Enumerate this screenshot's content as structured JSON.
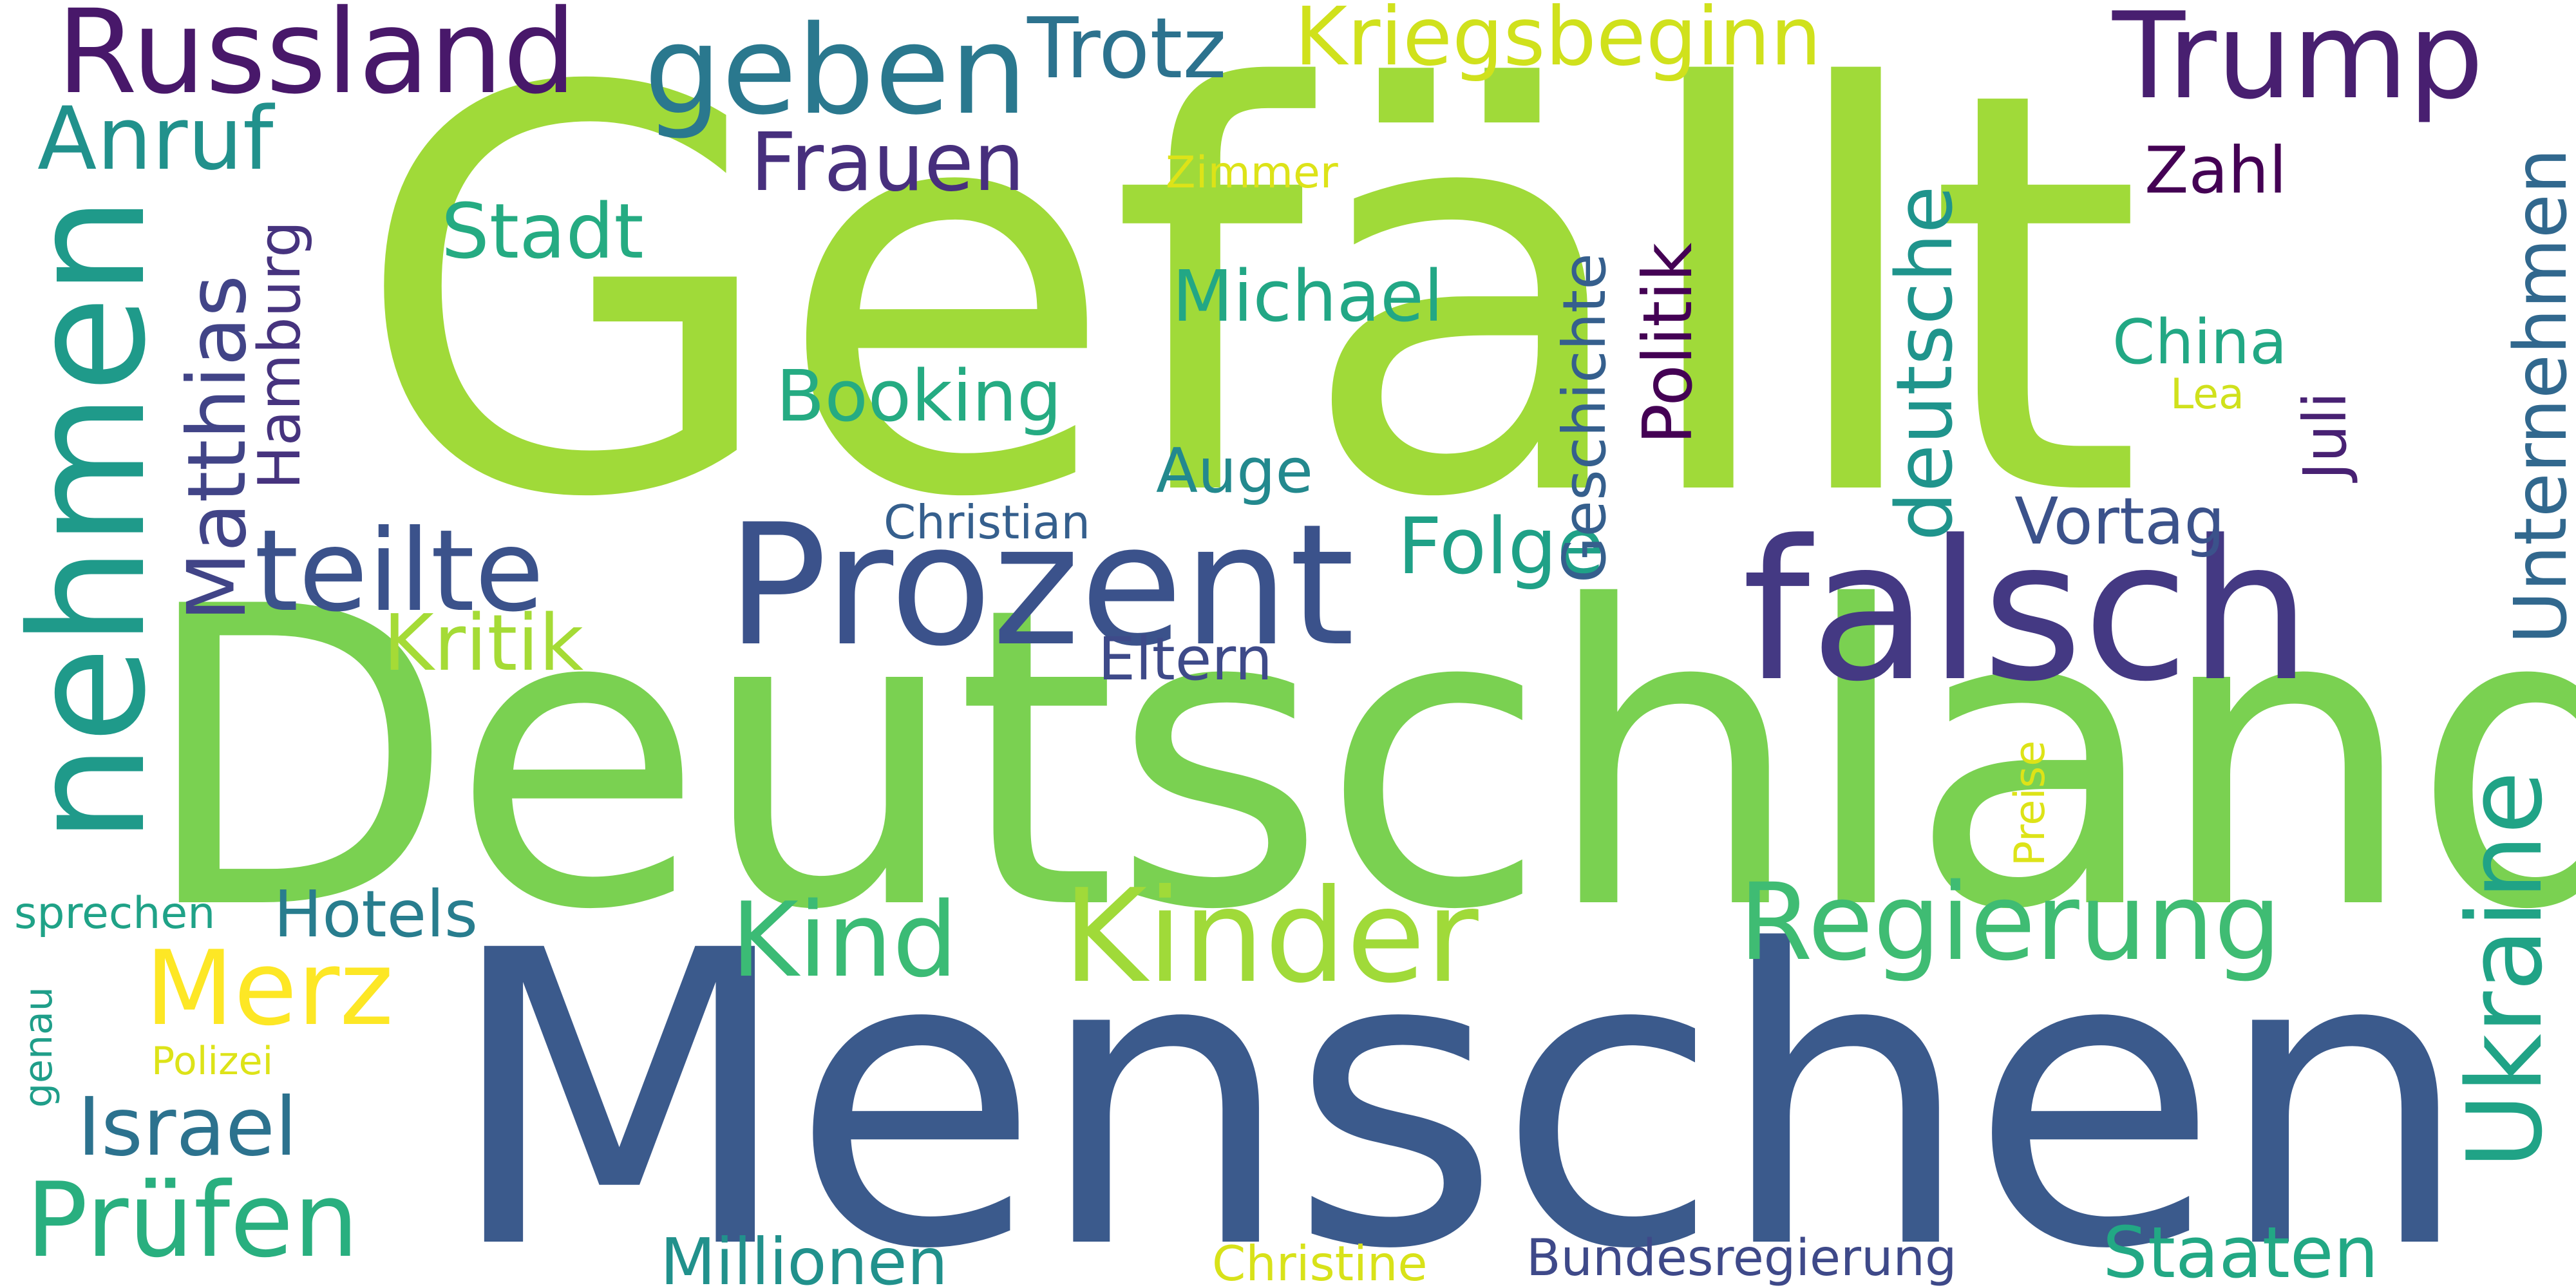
{
  "words": {
    "gefaellt": {
      "text": "Gefällt",
      "color": "#a0da39"
    },
    "deutschland": {
      "text": "Deutschland",
      "color": "#7ad151"
    },
    "menschen": {
      "text": "Menschen",
      "color": "#3b5a8c"
    },
    "prozent": {
      "text": "Prozent",
      "color": "#3b528b"
    },
    "falsch": {
      "text": "falsch",
      "color": "#443983"
    },
    "nehmen": {
      "text": "nehmen",
      "color": "#1f9a8a"
    },
    "kinder": {
      "text": "Kinder",
      "color": "#a0da39"
    },
    "russland": {
      "text": "Russland",
      "color": "#48186a"
    },
    "trump": {
      "text": "Trump",
      "color": "#481f70"
    },
    "geben": {
      "text": "geben",
      "color": "#2a788e"
    },
    "kriegsbeginn": {
      "text": "Kriegsbeginn",
      "color": "#d0e11c"
    },
    "trotz": {
      "text": "Trotz",
      "color": "#2c728e"
    },
    "anruf": {
      "text": "Anruf",
      "color": "#21918c"
    },
    "frauen": {
      "text": "Frauen",
      "color": "#472f7d"
    },
    "zimmer": {
      "text": "Zimmer",
      "color": "#dde318"
    },
    "zahl": {
      "text": "Zahl",
      "color": "#440154"
    },
    "stadt": {
      "text": "Stadt",
      "color": "#25ab82"
    },
    "michael": {
      "text": "Michael",
      "color": "#22a785"
    },
    "china": {
      "text": "China",
      "color": "#22a884"
    },
    "lea": {
      "text": "Lea",
      "color": "#d0e11c"
    },
    "booking": {
      "text": "Booking",
      "color": "#25ab82"
    },
    "auge": {
      "text": "Auge",
      "color": "#23898e"
    },
    "christian": {
      "text": "Christian",
      "color": "#355f8d"
    },
    "vortag": {
      "text": "Vortag",
      "color": "#3b528b"
    },
    "teilte": {
      "text": "teilte",
      "color": "#3b528b"
    },
    "folge": {
      "text": "Folge",
      "color": "#1fa187"
    },
    "kritik": {
      "text": "Kritik",
      "color": "#a5db36"
    },
    "eltern": {
      "text": "Eltern",
      "color": "#3e4a89"
    },
    "matthias": {
      "text": "Matthias",
      "color": "#414487"
    },
    "hamburg": {
      "text": "Hamburg",
      "color": "#46337e"
    },
    "geschichte": {
      "text": "Geschichte",
      "color": "#355f8d"
    },
    "politik": {
      "text": "Politik",
      "color": "#440154"
    },
    "deutsche": {
      "text": "deutsche",
      "color": "#1f948c"
    },
    "juli": {
      "text": "Juli",
      "color": "#482173"
    },
    "unternehmen": {
      "text": "Unternehmen",
      "color": "#31688e"
    },
    "ukraine": {
      "text": "Ukraine",
      "color": "#20a386"
    },
    "preise": {
      "text": "Preise",
      "color": "#dde318"
    },
    "kind": {
      "text": "Kind",
      "color": "#3bbb75"
    },
    "regierung": {
      "text": "Regierung",
      "color": "#3fbc73"
    },
    "merz": {
      "text": "Merz",
      "color": "#fde725"
    },
    "hotels": {
      "text": "Hotels",
      "color": "#287d8e"
    },
    "sprechen": {
      "text": "sprechen",
      "color": "#1fa287"
    },
    "genau": {
      "text": "genau",
      "color": "#1f9e89"
    },
    "polizei": {
      "text": "Polizei",
      "color": "#dde318"
    },
    "israel": {
      "text": "Israel",
      "color": "#2c728e"
    },
    "pruefen": {
      "text": "Prüfen",
      "color": "#29af7f"
    },
    "millionen": {
      "text": "Millionen",
      "color": "#21918c"
    },
    "christine": {
      "text": "Christine",
      "color": "#d8e219"
    },
    "bundesregierung": {
      "text": "Bundesregierung",
      "color": "#3e4989"
    },
    "staaten": {
      "text": "Staaten",
      "color": "#22a884"
    }
  }
}
